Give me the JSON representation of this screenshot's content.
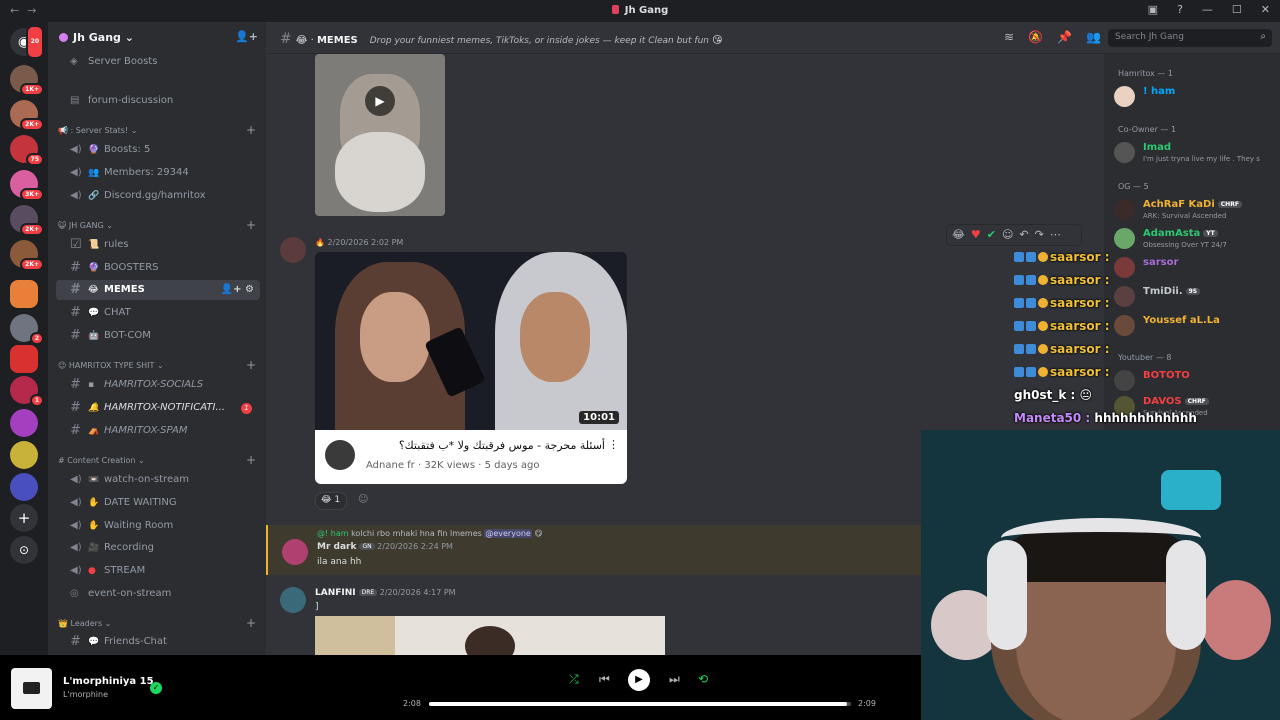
{
  "window": {
    "title": "Jh Gang"
  },
  "guilds": {
    "home_badge": "20",
    "badges": [
      "1K+",
      "2K+",
      "75",
      "3K+",
      "2K+",
      "2K+",
      "2",
      "1"
    ]
  },
  "sidebar": {
    "server_name": "Jh Gang",
    "items": {
      "server_boosts": "Server Boosts",
      "forum": "forum-discussion",
      "stats_cat": ": Server Stats!",
      "boosts": "Boosts: 5",
      "members": "Members: 29344",
      "discord": "Discord.gg/hamritox",
      "jh_cat": "JH GANG",
      "rules": "rules",
      "boosters": "BOOSTERS",
      "memes": "MEMES",
      "chat": "CHAT",
      "botcom": "BOT-COM",
      "type_cat": "HAMRITOX TYPE SHIT",
      "socials": "HAMRITOX-SOCIALS",
      "notifications": "HAMRITOX-NOTIFICATI...",
      "notif_badge": "1",
      "spam": "HAMRITOX-SPAM",
      "content_cat": "Content Creation",
      "watch": "watch-on-stream",
      "date": "DATE WAITING",
      "waiting": "Waiting Room",
      "recording": "Recording",
      "stream": "STREAM",
      "event": "event-on-stream",
      "leaders_cat": "Leaders",
      "friends": "Friends-Chat"
    }
  },
  "channel": {
    "name": "MEMES",
    "topic": "Drop your funniest memes, TikToks, or inside jokes — keep it Clean but fun",
    "search_placeholder": "Search Jh Gang"
  },
  "messages": {
    "m1_timestamp": "2/20/2026 2:02 PM",
    "yt_title": "أسئلة محرجة - موس فرقبتك ولا *ب فتقبتك؟",
    "yt_channel": "Adnane fr",
    "yt_views": "32K views",
    "yt_age": "5 days ago",
    "yt_duration": "10:01",
    "reaction_count": "1",
    "reply_user": "@! ham",
    "reply_text": "kolchi rbo mhaki hna fin lmemes",
    "reply_mention": "@everyone",
    "m2_user": "Mr dark",
    "m2_tag": "GN",
    "m2_time": "2/20/2026 2:24 PM",
    "m2_text": "ila ana hh",
    "m3_user": "LANFINI",
    "m3_tag": "DRE",
    "m3_time": "2/20/2026 4:17 PM",
    "m3_text": "]"
  },
  "members_list": {
    "cat_hamritox": "Hamritox — 1",
    "m_ham": "! ham",
    "cat_coowner": "Co-Owner — 1",
    "m_imad": "Imad",
    "m_imad_status": "I'm just tryna live my life . They s",
    "cat_og": "OG — 5",
    "m_achraf": "AchRaF KaDi",
    "m_achraf_tag": "CHRF",
    "m_achraf_status": "ARK: Survival Ascended",
    "m_adam": "AdamAsta",
    "m_adam_tag": "YT",
    "m_adam_status": "Obsessing Over YT 24/7",
    "m_sarsor": "sarsor",
    "m_tmidii": "TmiDii.",
    "m_tmidii_tag": "9S",
    "m_youssef": "Youssef aL.La",
    "cat_youtuber": "Youtuber — 8",
    "m_bototo": "BOTOTO",
    "m_davos": "DAVOS",
    "m_davos_tag": "CHRF",
    "m_davos_status": "Survival Ascended"
  },
  "overlay_chat": {
    "rows": [
      "saarsor :",
      "saarsor :",
      "saarsor :",
      "saarsor :",
      "saarsor :",
      "saarsor :"
    ],
    "gh0st": "gh0st_k :",
    "maneta_user": "Maneta50 :",
    "maneta_text": "hhhhhhhhhhhh"
  },
  "player": {
    "track": "L'morphiniya 15",
    "artist": "L'morphine",
    "elapsed": "2:08",
    "total": "2:09",
    "progress": 0.99
  },
  "colors": {
    "accent": "#5865f2",
    "mention_bg": "#3e3a2e",
    "overlay_name": "#f0c03a",
    "spotify_green": "#1ed760"
  }
}
